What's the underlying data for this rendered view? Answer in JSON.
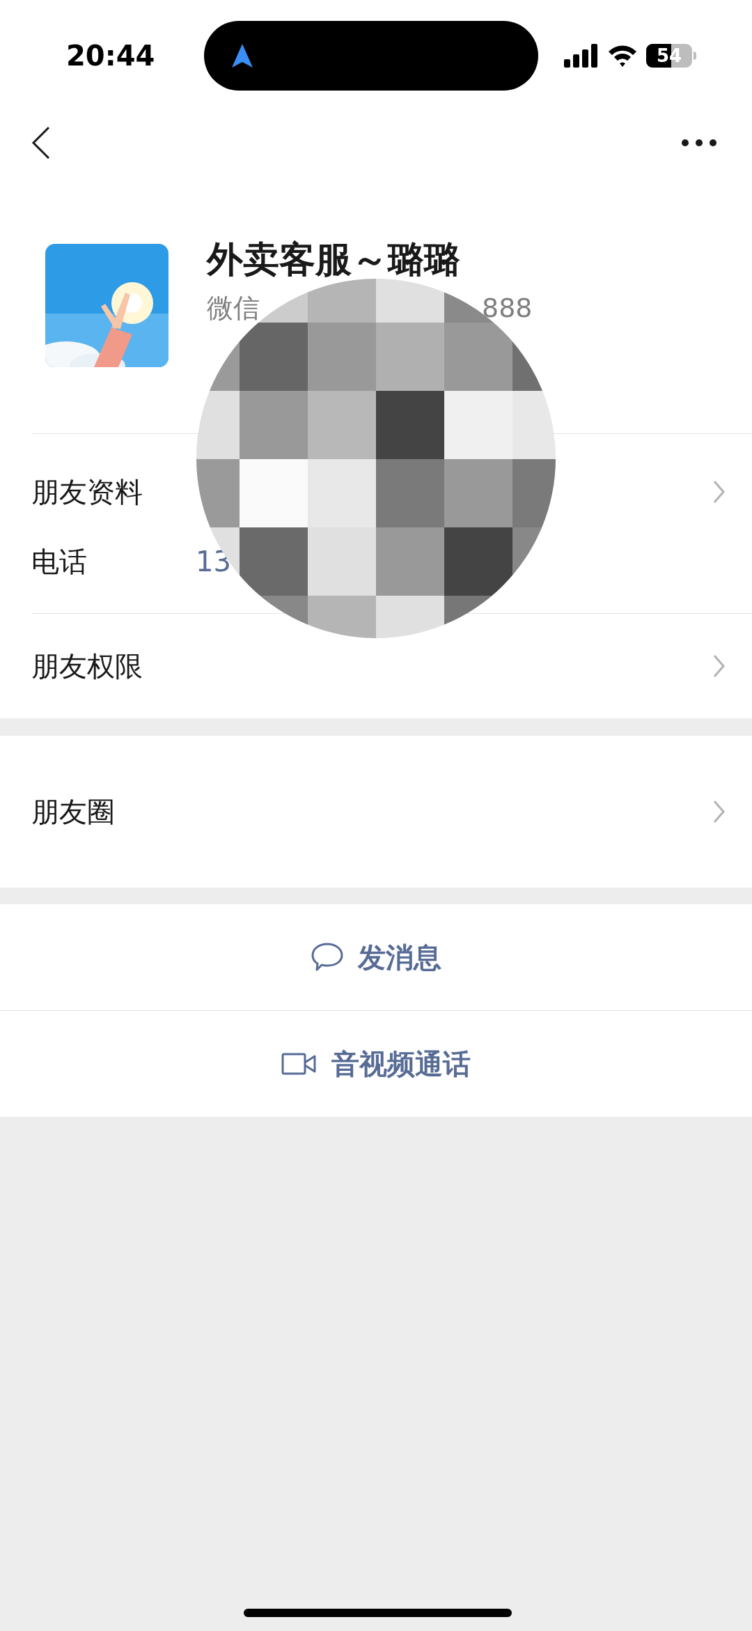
{
  "status_bar": {
    "time": "20:44",
    "battery": "54"
  },
  "profile": {
    "name": "外卖客服～璐璐",
    "id_start": "微信",
    "id_end": "888"
  },
  "sections": [
    {
      "blocks": [
        {
          "rows": [
            {
              "kind": "link",
              "label": "朋友资料"
            },
            {
              "kind": "phone",
              "label": "电话",
              "value": "13"
            }
          ]
        },
        {
          "rows": [
            {
              "kind": "link",
              "label": "朋友权限"
            }
          ]
        }
      ]
    },
    {
      "blocks": [
        {
          "rows": [
            {
              "kind": "link",
              "label": "朋友圈"
            }
          ]
        }
      ]
    }
  ],
  "actions": [
    {
      "kind": "message",
      "label": "发消息"
    },
    {
      "kind": "video",
      "label": "音视频通话"
    }
  ]
}
